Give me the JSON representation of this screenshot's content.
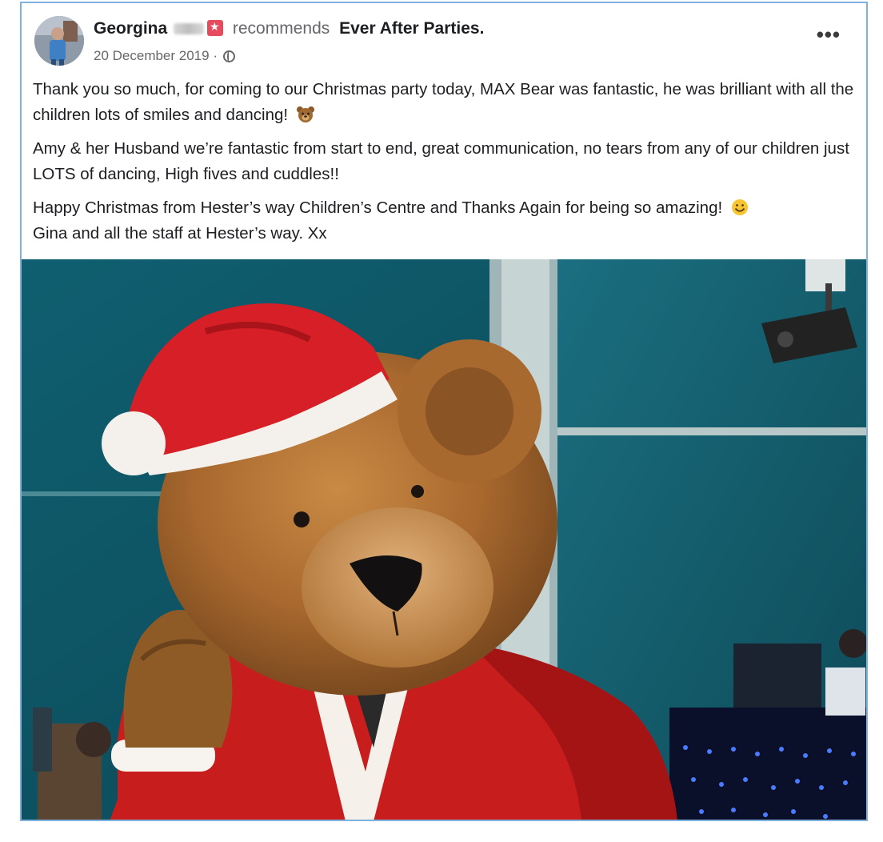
{
  "post": {
    "author_first": "Georgina",
    "verb": "recommends",
    "page_name": "Ever After Parties.",
    "date": "20 December 2019 ·",
    "more_label": "•••",
    "paragraphs": {
      "p1": "Thank you so much, for coming to our Christmas party today, MAX Bear was fantastic, he was brilliant with all the children lots of smiles and dancing!",
      "p2": "Amy & her Husband we’re fantastic from start to end, great communication, no tears from any of our children just LOTS of dancing, High fives and cuddles!!",
      "p3": "Happy Christmas from Hester’s way Children’s Centre and Thanks Again for being so amazing!",
      "p4": "Gina and all the staff at Hester’s way. Xx"
    },
    "icons": {
      "recommend": "recommend-badge-icon",
      "audience": "globe-icon",
      "p1_emoji": "bear-face-icon",
      "p3_emoji": "smiley-face-icon"
    },
    "colors": {
      "recommend": "#e64b5d",
      "border": "#7fb3de",
      "meta_text": "#65676b"
    }
  }
}
